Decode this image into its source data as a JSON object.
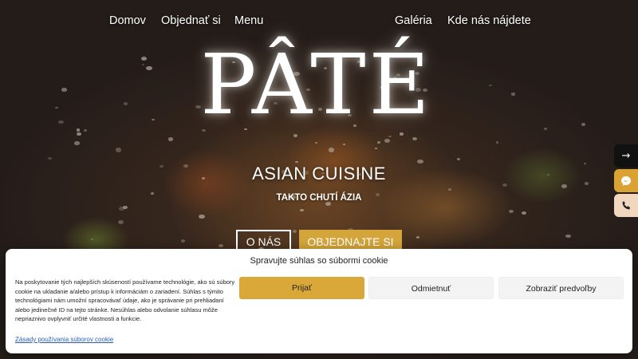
{
  "nav": {
    "home": "Domov",
    "order": "Objednať si",
    "menu": "Menu",
    "gallery": "Galéria",
    "find_us": "Kde nás nájdete"
  },
  "hero": {
    "logo": "PÂTÉ",
    "tagline": "ASIAN CUISINE",
    "subtagline": "TAKTO CHUTÍ ÁZIA",
    "about_button": "O NÁS",
    "order_button": "OBJEDNAJTE SI"
  },
  "side": {
    "arrow": "→"
  },
  "colors": {
    "accent": "#d4a53a",
    "messenger": "#d9a233",
    "phone_bg": "#f1d7bd"
  },
  "cookie": {
    "title": "Spravujte súhlas so súbormi cookie",
    "text": "Na poskytovanie tých najlepších skúseností používame technológie, ako sú súbory cookie na ukladanie a/alebo prístup k informáciám o zariadení. Súhlas s týmito technológiami nám umožní spracovávať údaje, ako je správanie pri prehliadaní alebo jedinečné ID na tejto stránke. Nesúhlas alebo odvolanie súhlasu môže nepriaznivo ovplyvniť určité vlastnosti a funkcie.",
    "policy_link": "Zásady používania súborov cookie",
    "accept": "Prijať",
    "deny": "Odmietnuť",
    "preferences": "Zobraziť predvoľby"
  }
}
